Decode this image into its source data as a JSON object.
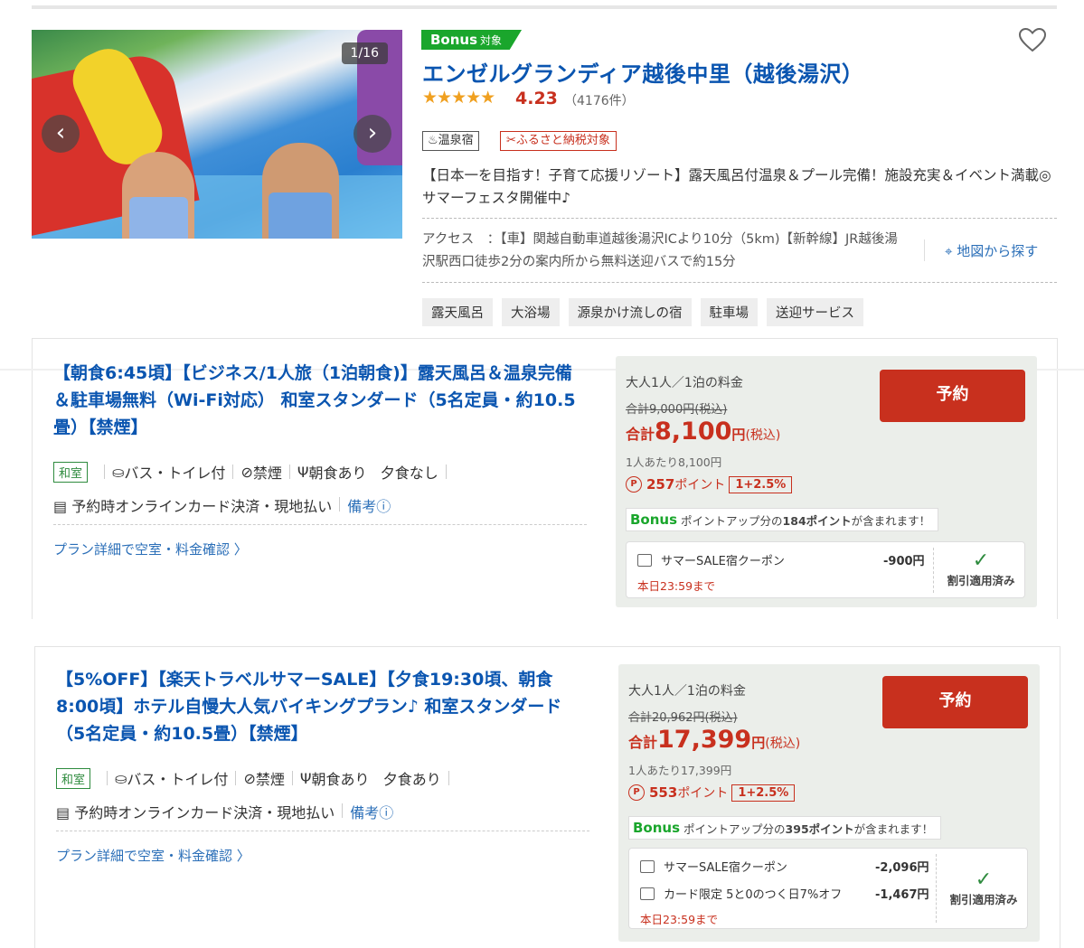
{
  "hotel": {
    "image_counter": "1/16",
    "bonus_label": "Bonus",
    "bonus_sub": "対象",
    "name": "エンゼルグランディア越後中里（越後湯沢）",
    "stars": "★★★★★",
    "rating": "4.23",
    "review_count": "（4176件）",
    "badges": [
      "♨温泉宿",
      "✂ふるさと納税対象"
    ],
    "catch_copy": "【日本一を目指す！子育て応援リゾート】露天風呂付温泉＆プール完備！施設充実＆イベント満載◎サマーフェスタ開催中♪",
    "access_label": "アクセス",
    "access_text": "：【車】関越自動車道越後湯沢ICより10分（5km)【新幹線】JR越後湯沢駅西口徒歩2分の案内所から無料送迎バスで約15分",
    "map_link": "地図から探す",
    "tags": [
      "露天風呂",
      "大浴場",
      "源泉かけ流しの宿",
      "駐車場",
      "送迎サービス"
    ]
  },
  "plans": [
    {
      "title": "【朝食6:45頃】【ビジネス/1人旅（1泊朝食)】露天風呂＆温泉完備＆駐車場無料（Wi-Fi対応） 和室スタンダード（5名定員・約10.5畳）【禁煙】",
      "room_type": "和室",
      "bath": "バス・トイレ付",
      "smoking": "禁煙",
      "breakfast": "朝食あり",
      "dinner": "夕食なし",
      "payment": "予約時オンラインカード決済・現地払い",
      "note": "備考ⓘ",
      "detail_link": "プラン詳細で空室・料金確認 〉",
      "price_label": "大人1人／1泊の料金",
      "original_price": "合計9,000円(税込)",
      "total_prefix": "合計",
      "total_amount": "8,100",
      "total_unit": "円",
      "total_tax": "(税込)",
      "per_person": "1人あたり8,100円",
      "points": "257",
      "points_unit": "ポイント",
      "point_rate": "1+2.5%",
      "bonus_word": "Bonus",
      "bonus_pre": "ポイントアップ分の",
      "bonus_points": "184ポイント",
      "bonus_post": "が含まれます！",
      "reserve": "予約",
      "coupons": [
        {
          "name": "サマーSALE宿クーポン",
          "amount": "-900円"
        }
      ],
      "coupon_expiry": "本日23:59まで",
      "applied": "割引適用済み"
    },
    {
      "title": "【5%OFF】【楽天トラベルサマーSALE】【夕食19:30頃、朝食8:00頃】ホテル自慢大人気バイキングプラン♪ 和室スタンダード（5名定員・約10.5畳）【禁煙】",
      "room_type": "和室",
      "bath": "バス・トイレ付",
      "smoking": "禁煙",
      "breakfast": "朝食あり",
      "dinner": "夕食あり",
      "payment": "予約時オンラインカード決済・現地払い",
      "note": "備考ⓘ",
      "detail_link": "プラン詳細で空室・料金確認 〉",
      "price_label": "大人1人／1泊の料金",
      "original_price": "合計20,962円(税込)",
      "total_prefix": "合計",
      "total_amount": "17,399",
      "total_unit": "円",
      "total_tax": "(税込)",
      "per_person": "1人あたり17,399円",
      "points": "553",
      "points_unit": "ポイント",
      "point_rate": "1+2.5%",
      "bonus_word": "Bonus",
      "bonus_pre": "ポイントアップ分の",
      "bonus_points": "395ポイント",
      "bonus_post": "が含まれます！",
      "reserve": "予約",
      "coupons": [
        {
          "name": "サマーSALE宿クーポン",
          "amount": "-2,096円"
        },
        {
          "name": "カード限定 5と0のつく日7%オフ",
          "amount": "-1,467円"
        }
      ],
      "coupon_expiry": "本日23:59まで",
      "applied": "割引適用済み"
    }
  ],
  "colors": {
    "brand_blue": "#0a55b0",
    "price_red": "#c8301e",
    "bonus_green": "#1aa62c",
    "price_bg": "#ebeeea"
  },
  "icons": [
    "heart-icon",
    "chevron-left-icon",
    "chevron-right-icon",
    "onsen-icon",
    "scissors-icon",
    "map-pin-icon",
    "bath-icon",
    "no-smoking-icon",
    "fork-knife-icon",
    "card-icon",
    "point-icon",
    "coupon-icon",
    "check-icon"
  ]
}
